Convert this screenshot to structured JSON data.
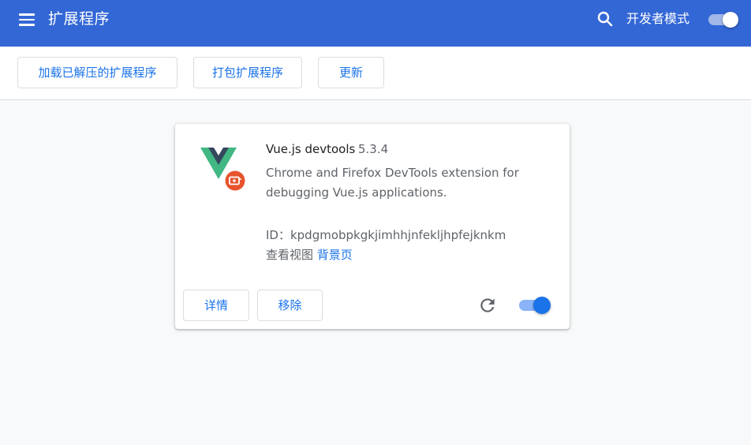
{
  "header": {
    "title": "扩展程序",
    "menu_icon": "hamburger-menu-icon",
    "search_icon": "search-icon",
    "dev_mode_label": "开发者模式",
    "dev_mode_on": true,
    "background_color": "#3367d6"
  },
  "toolbar": {
    "load_unpacked_label": "加载已解压的扩展程序",
    "pack_label": "打包扩展程序",
    "update_label": "更新"
  },
  "extension": {
    "name": "Vue.js devtools",
    "version": "5.3.4",
    "description": "Chrome and Firefox DevTools extension for debugging Vue.js applications.",
    "id_text": "ID：kpdgmobpkgkjimhhjnfekljhpfejknkm",
    "views_label": "查看视图",
    "background_page_link": "背景页",
    "details_label": "详情",
    "remove_label": "移除",
    "reload_icon": "reload-icon",
    "enabled": true,
    "logo_icon": "vue-logo-icon",
    "badge_icon": "developer-mode-badge-icon",
    "accent_color": "#1a73e8"
  }
}
